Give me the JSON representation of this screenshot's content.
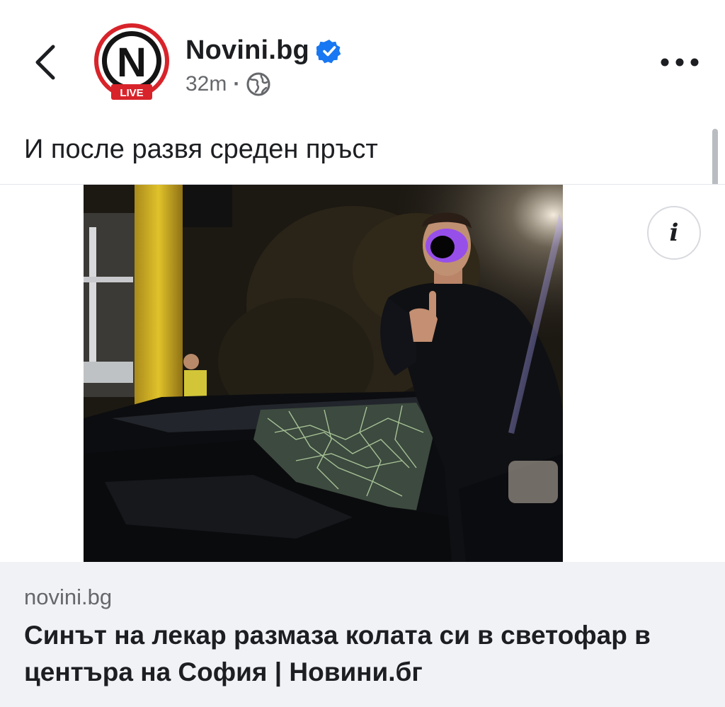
{
  "header": {
    "page_name": "Novini.bg",
    "avatar_letter": "N",
    "avatar_badge": "LIVE",
    "time": "32m",
    "separator": "·",
    "audience_icon": "globe-icon",
    "verified_icon": "verified-badge-icon",
    "back_icon": "chevron-left-icon",
    "more_icon": "more-horizontal-icon"
  },
  "post": {
    "text": "И после развя среден пръст",
    "info_label": "i"
  },
  "link": {
    "domain": "novini.bg",
    "title": "Синът на лекар размаза колата си в светофар в центъра на София | Новини.бг"
  },
  "colors": {
    "brand_red": "#d8232a",
    "verified_blue": "#1877f2",
    "secondary_text": "#65676b",
    "card_bg": "#f0f2f5"
  }
}
